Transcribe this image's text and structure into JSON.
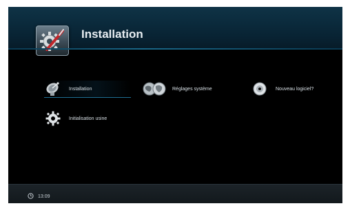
{
  "header": {
    "title": "Installation",
    "icon": "tools-icon"
  },
  "menu": {
    "items": [
      {
        "label": "Installation",
        "icon": "satellite-dish-icon",
        "selected": true
      },
      {
        "label": "Réglages système",
        "icon": "globe-icon",
        "selected": false
      },
      {
        "label": "Nouveau logiciel?",
        "icon": "disc-icon",
        "selected": false
      },
      {
        "label": "Initialisation usine",
        "icon": "gear-icon",
        "selected": false
      }
    ]
  },
  "footer": {
    "time": "13:09",
    "clock_icon": "clock-icon"
  },
  "colors": {
    "header_bg": "#0b2b3d",
    "accent": "#1f6f94",
    "screen_bg": "#000000",
    "footer_bg": "#1a2126"
  }
}
